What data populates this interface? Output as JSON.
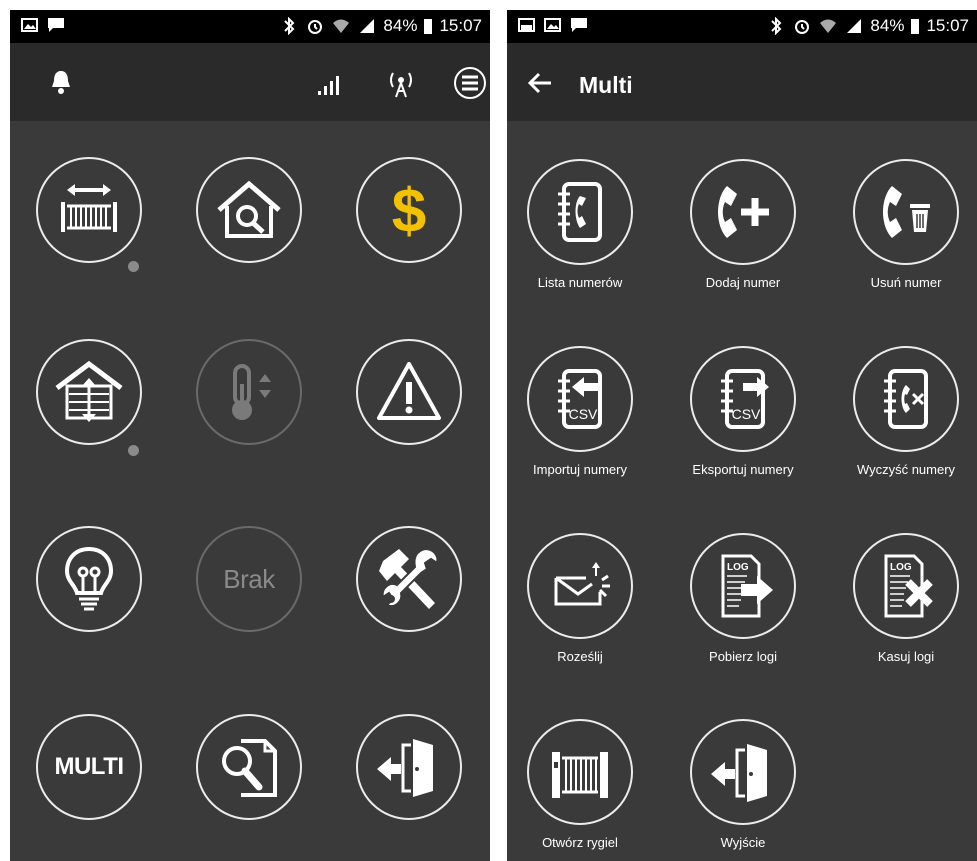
{
  "left_screen": {
    "status": {
      "battery": "84%",
      "time": "15:07"
    },
    "toolbar": {
      "bell_icon": "bell-icon",
      "signal_icon": "signal-bars-icon",
      "antenna_icon": "antenna-icon",
      "menu_icon": "hamburger-menu-icon"
    },
    "tiles": [
      {
        "icon": "sliding-gate-icon"
      },
      {
        "icon": "house-search-icon"
      },
      {
        "icon": "dollar-icon",
        "color": "#f2c200"
      },
      {
        "icon": "garage-door-icon"
      },
      {
        "icon": "thermometer-icon",
        "disabled": true
      },
      {
        "icon": "warning-icon"
      },
      {
        "icon": "light-bulb-icon"
      },
      {
        "label": "Brak",
        "disabled": true
      },
      {
        "icon": "tools-icon"
      },
      {
        "label": "MULTI"
      },
      {
        "icon": "document-search-icon"
      },
      {
        "icon": "exit-door-icon"
      }
    ]
  },
  "right_screen": {
    "status": {
      "battery": "84%",
      "time": "15:07"
    },
    "title": "Multi",
    "back_icon": "back-arrow-icon",
    "items": [
      {
        "label": "Lista numerów",
        "icon": "phonebook-icon"
      },
      {
        "label": "Dodaj numer",
        "icon": "phone-add-icon"
      },
      {
        "label": "Usuń numer",
        "icon": "phone-delete-icon"
      },
      {
        "label": "Importuj numery",
        "icon": "import-csv-icon"
      },
      {
        "label": "Eksportuj numery",
        "icon": "export-csv-icon"
      },
      {
        "label": "Wyczyść numery",
        "icon": "clear-numbers-icon"
      },
      {
        "label": "Roześlij",
        "icon": "send-envelope-icon"
      },
      {
        "label": "Pobierz logi",
        "icon": "download-log-icon"
      },
      {
        "label": "Kasuj logi",
        "icon": "delete-log-icon"
      },
      {
        "label": "Otwórz rygiel",
        "icon": "gate-open-icon"
      },
      {
        "label": "Wyjście",
        "icon": "exit-door-icon"
      }
    ],
    "csv_text": "CSV",
    "log_text": "LOG"
  },
  "colors": {
    "background": "#3a3a3a",
    "appbar": "#2a2a2a",
    "statusbar": "#000000",
    "accent_yellow": "#f2c200"
  }
}
